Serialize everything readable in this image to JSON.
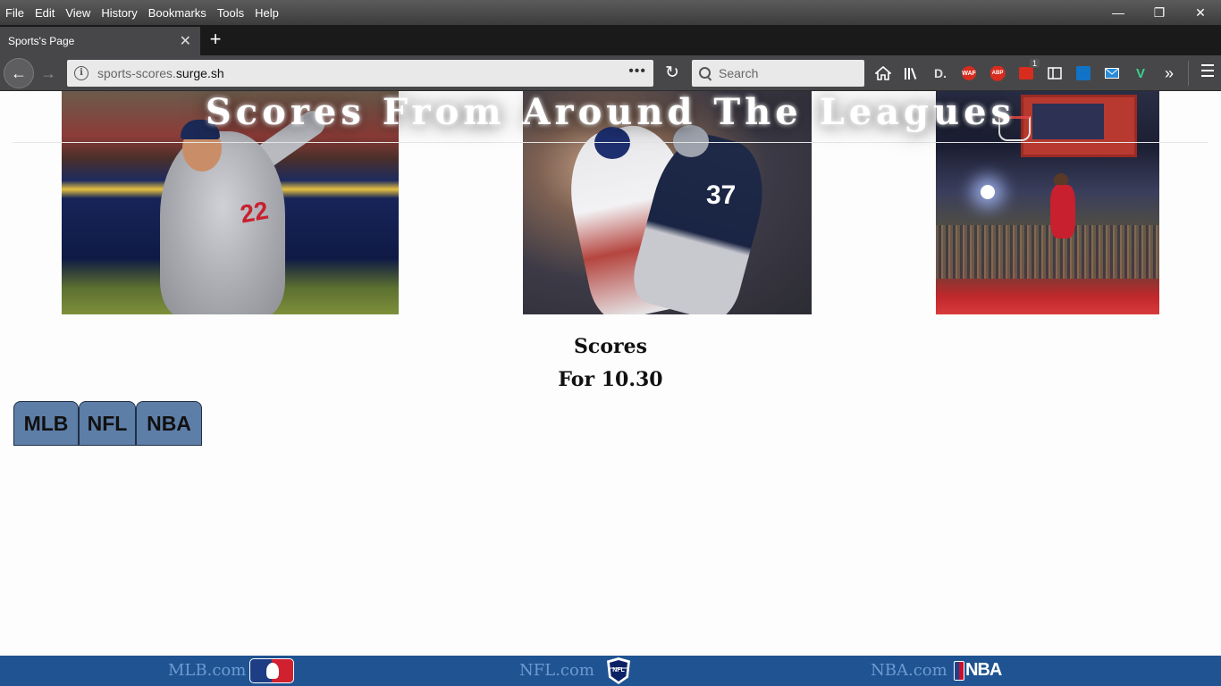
{
  "browser": {
    "menu": [
      "File",
      "Edit",
      "View",
      "History",
      "Bookmarks",
      "Tools",
      "Help"
    ],
    "window_controls": [
      "minimize",
      "restore",
      "close"
    ],
    "tab": {
      "title": "Sports's Page",
      "close_symbol": "✕"
    },
    "new_tab_symbol": "+",
    "address": {
      "subdomain": "sports-scores.",
      "host": "surge.sh"
    },
    "page_actions_symbol": "•••",
    "search_placeholder": "Search",
    "toolbar_icons": [
      "home-icon",
      "library-icon",
      "d-extension-icon",
      "waf-shield-icon",
      "abp-icon",
      "extension-badge-icon",
      "reader-sidebar-icon",
      "outlook-icon",
      "mail-icon",
      "v-extension-icon",
      "overflow-chevron-icon",
      "hamburger-menu-icon"
    ],
    "badges": {
      "waf": "WAF",
      "abp": "ABP",
      "count": "1",
      "d": "D."
    }
  },
  "page": {
    "hero_title": "Scores From Around The Leagues",
    "hero_images": [
      "baseball-pitcher-photo",
      "football-tackle-photo",
      "basketball-dunk-photo"
    ],
    "scores_heading": "Scores",
    "scores_date": "For 10.30",
    "league_tabs": [
      {
        "label": "MLB"
      },
      {
        "label": "NFL"
      },
      {
        "label": "NBA"
      }
    ],
    "colors": {
      "tab_bg": "#5d7ea7",
      "footer_bg": "#1f5391",
      "footer_link": "#6d9ad3"
    }
  },
  "footer": {
    "links": [
      {
        "label": "MLB.com",
        "logo": "mlb-logo-icon"
      },
      {
        "label": "NFL.com",
        "logo": "nfl-logo-icon"
      },
      {
        "label": "NBA.com",
        "logo": "nba-logo-icon"
      }
    ],
    "nba_logo_text": "NBA",
    "nfl_logo_text": "NFL"
  }
}
